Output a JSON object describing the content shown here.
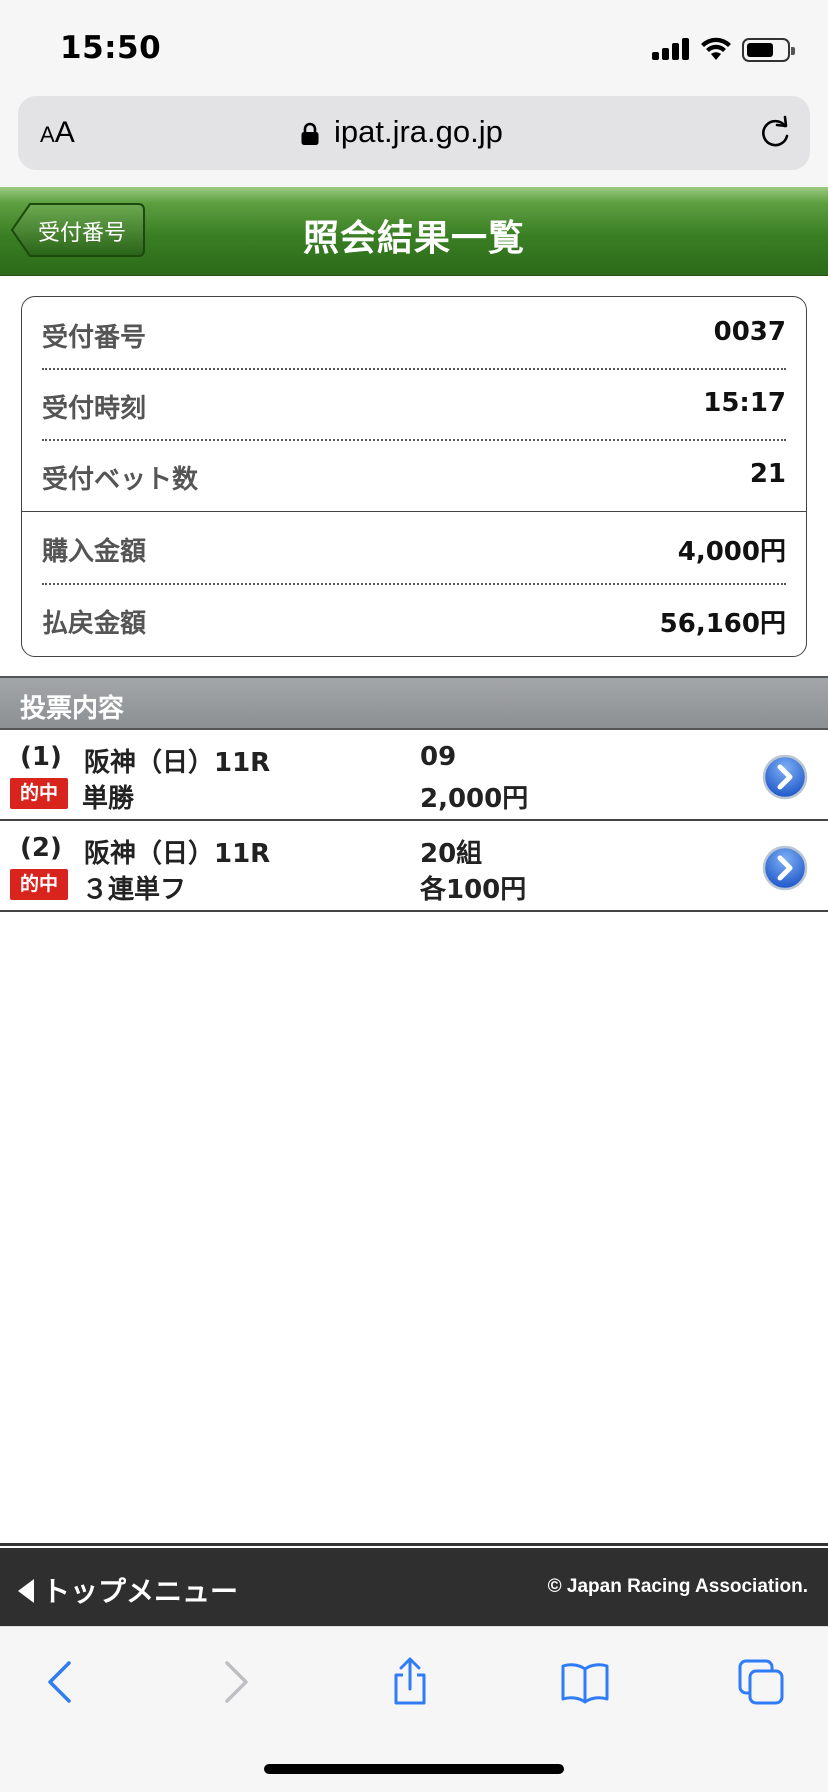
{
  "status_bar": {
    "time": "15:50"
  },
  "browser": {
    "text_size_small": "A",
    "text_size_large": "A",
    "url": "ipat.jra.go.jp"
  },
  "header": {
    "back_label": "受付番号",
    "title": "照会結果一覧"
  },
  "info": {
    "rows": [
      {
        "label": "受付番号",
        "value": "0037"
      },
      {
        "label": "受付時刻",
        "value": "15:17"
      },
      {
        "label": "受付ベット数",
        "value": "21"
      },
      {
        "label": "購入金額",
        "value": "4,000円"
      },
      {
        "label": "払戻金額",
        "value": "56,160円"
      }
    ]
  },
  "section": {
    "title": "投票内容"
  },
  "votes": [
    {
      "index": "(1)",
      "race": "阪神（日）11R",
      "badge": "的中",
      "type": "単勝",
      "selection": "09",
      "amount": "2,000円"
    },
    {
      "index": "(2)",
      "race": "阪神（日）11R",
      "badge": "的中",
      "type": "３連単フ",
      "selection": "20組",
      "amount": "各100円"
    }
  ],
  "footer": {
    "top_menu": "トップメニュー",
    "copyright": "© Japan Racing Association."
  },
  "colors": {
    "header_green": "#3a7f24",
    "hit_red": "#d8241d",
    "ios_blue": "#2f7cf6",
    "footer_dark": "#2f2f2f"
  }
}
